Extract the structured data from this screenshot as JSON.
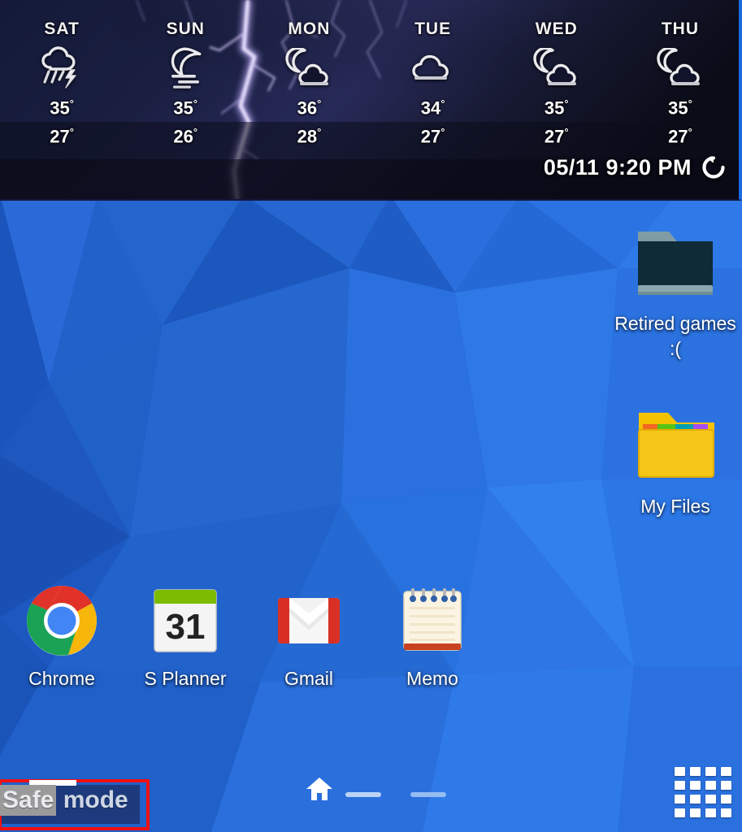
{
  "screen": {
    "type": "android-home-screen",
    "state_label": "Safe mode",
    "wallpaper_color": "#1f63d6",
    "accent_color": "#1b6ae0"
  },
  "weather_widget": {
    "name": "weather-forecast-widget",
    "background_color": "#0d0f1e",
    "timestamp": "05/11 9:20 PM",
    "refresh_icon": "refresh-icon",
    "days": [
      {
        "day": "SAT",
        "icon": "thunderstorm-rain-icon",
        "high": "35",
        "low": "27",
        "degree": "°"
      },
      {
        "day": "SUN",
        "icon": "moon-haze-icon",
        "high": "35",
        "low": "26",
        "degree": "°"
      },
      {
        "day": "MON",
        "icon": "moon-cloud-icon",
        "high": "36",
        "low": "28",
        "degree": "°"
      },
      {
        "day": "TUE",
        "icon": "cloud-icon",
        "high": "34",
        "low": "27",
        "degree": "°"
      },
      {
        "day": "WED",
        "icon": "moon-cloud-icon",
        "high": "35",
        "low": "27",
        "degree": "°"
      },
      {
        "day": "THU",
        "icon": "moon-cloud-icon",
        "high": "35",
        "low": "27",
        "degree": "°"
      }
    ]
  },
  "desktop_icons": [
    {
      "label": "Retired games :(",
      "icon": "folder-dark-icon",
      "color": "#0f2b38"
    },
    {
      "label": "My Files",
      "icon": "folder-yellow-icon",
      "color": "#f5c518"
    }
  ],
  "app_row": [
    {
      "label": "Chrome",
      "icon": "chrome-icon"
    },
    {
      "label": "S Planner",
      "icon": "calendar-icon",
      "badge": "31"
    },
    {
      "label": "Gmail",
      "icon": "gmail-icon"
    },
    {
      "label": "Memo",
      "icon": "memo-notepad-icon"
    }
  ],
  "bottom_bar": {
    "home_icon": "home-icon",
    "apps_grid_icon": "apps-grid-icon",
    "page_indicators": [
      {
        "state": "active"
      },
      {
        "state": "inactive"
      }
    ]
  },
  "safe_mode": {
    "selected_word": "Safe",
    "rest_word": " mode",
    "annotation_color": "#ee1111",
    "chip_color": "#1d3a7c",
    "selection_color": "#9a9a9a"
  }
}
